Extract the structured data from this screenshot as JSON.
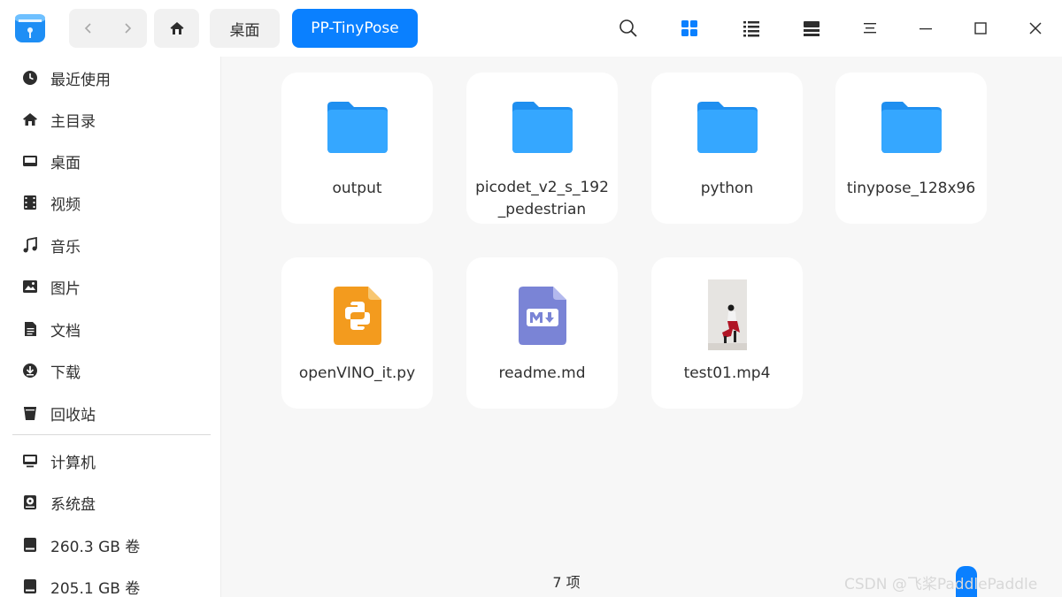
{
  "titlebar": {
    "breadcrumbs": [
      {
        "label": "桌面",
        "active": false
      },
      {
        "label": "PP-TinyPose",
        "active": true
      }
    ],
    "accent": "#0a80ff",
    "icons": [
      "file-manager-app-icon",
      "back-icon",
      "forward-icon",
      "home-icon",
      "search-icon",
      "icon-view-icon",
      "list-view-icon",
      "detail-view-icon",
      "menu-icon",
      "minimize-icon",
      "maximize-icon",
      "close-icon"
    ]
  },
  "sidebar": {
    "places": [
      {
        "label": "最近使用",
        "icon": "clock-icon"
      },
      {
        "label": "主目录",
        "icon": "home-icon"
      },
      {
        "label": "桌面",
        "icon": "desktop-icon"
      },
      {
        "label": "视频",
        "icon": "video-icon"
      },
      {
        "label": "音乐",
        "icon": "music-icon"
      },
      {
        "label": "图片",
        "icon": "picture-icon"
      },
      {
        "label": "文档",
        "icon": "document-icon"
      },
      {
        "label": "下载",
        "icon": "download-icon"
      },
      {
        "label": "回收站",
        "icon": "trash-icon"
      }
    ],
    "devices": [
      {
        "label": "计算机",
        "icon": "computer-icon"
      },
      {
        "label": "系统盘",
        "icon": "system-disk-icon"
      },
      {
        "label": "260.3 GB 卷",
        "icon": "drive-icon"
      },
      {
        "label": "205.1 GB 卷",
        "icon": "drive-icon"
      }
    ]
  },
  "files": [
    {
      "name": "output",
      "type": "folder"
    },
    {
      "name": "picodet_v2_s_192_pedestrian",
      "type": "folder"
    },
    {
      "name": "python",
      "type": "folder"
    },
    {
      "name": "tinypose_128x96",
      "type": "folder"
    },
    {
      "name": "openVINO_it.py",
      "type": "python-file"
    },
    {
      "name": "readme.md",
      "type": "markdown-file"
    },
    {
      "name": "test01.mp4",
      "type": "video-file"
    }
  ],
  "status": {
    "count": "7 项"
  },
  "watermark": "CSDN @飞桨PaddlePaddle"
}
